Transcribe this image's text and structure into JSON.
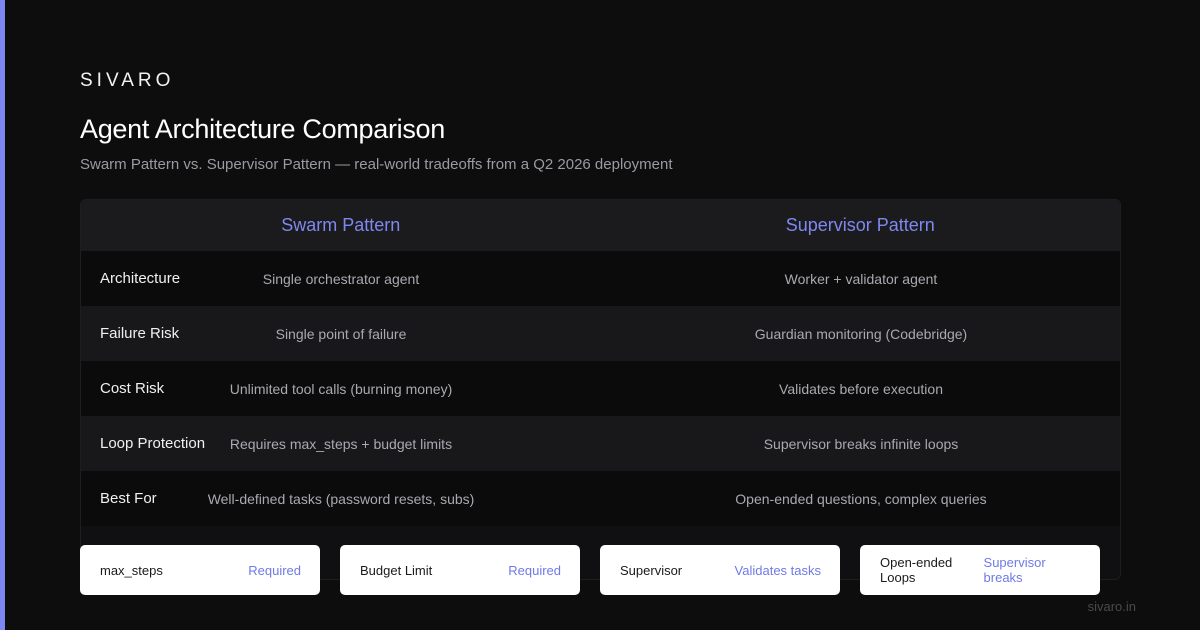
{
  "brand": "SIVARO",
  "title": "Agent Architecture Comparison",
  "subtitle": "Swarm Pattern vs. Supervisor Pattern — real-world tradeoffs from a Q2 2026 deployment",
  "table": {
    "headers": [
      "Swarm Pattern",
      "Supervisor Pattern"
    ],
    "rows": [
      {
        "label": "Architecture",
        "swarm": "Single orchestrator agent",
        "supervisor": "Worker + validator agent"
      },
      {
        "label": "Failure Risk",
        "swarm": "Single point of failure",
        "supervisor": "Guardian monitoring (Codebridge)"
      },
      {
        "label": "Cost Risk",
        "swarm": "Unlimited tool calls (burning money)",
        "supervisor": "Validates before execution"
      },
      {
        "label": "Loop Protection",
        "swarm": "Requires max_steps + budget limits",
        "supervisor": "Supervisor breaks infinite loops"
      },
      {
        "label": "Best For",
        "swarm": "Well-defined tasks (password resets, subs)",
        "supervisor": "Open-ended questions, complex queries"
      }
    ]
  },
  "cards": [
    {
      "key": "max_steps",
      "value": "Required"
    },
    {
      "key": "Budget Limit",
      "value": "Required"
    },
    {
      "key": "Supervisor",
      "value": "Validates tasks"
    },
    {
      "key": "Open-ended Loops",
      "value": "Supervisor breaks"
    }
  ],
  "footer": "sivaro.in",
  "colors": {
    "accent": "#7b86f0",
    "background": "#0d0d0e"
  }
}
